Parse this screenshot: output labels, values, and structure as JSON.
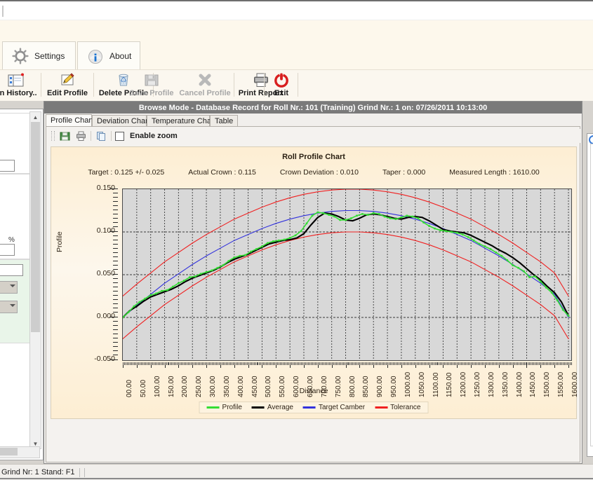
{
  "ribbon": {
    "tabs": [
      {
        "label": "Settings",
        "icon": "gear-icon"
      },
      {
        "label": "About",
        "icon": "info-icon"
      }
    ],
    "commands": [
      {
        "label": "en History..",
        "icon": "open-history-icon",
        "enabled": true
      },
      {
        "label": "Edit Profile",
        "icon": "pencil-icon",
        "enabled": true
      },
      {
        "label": "Delete Profile",
        "icon": "trash-icon",
        "enabled": true
      },
      {
        "label": "Save Profile",
        "icon": "floppy-disk-icon",
        "enabled": false
      },
      {
        "label": "Cancel Profile",
        "icon": "cross-icon",
        "enabled": false
      },
      {
        "label": "Print Report",
        "icon": "printer-icon",
        "enabled": true
      },
      {
        "label": "Exit",
        "icon": "power-icon",
        "enabled": true
      }
    ]
  },
  "window": {
    "title": "Browse Mode - Database Record for Roll Nr.: 101 (Training) Grind Nr.: 1 on: 07/26/2011 10:13:00"
  },
  "tabs": [
    {
      "label": "Profile Chart",
      "selected": true
    },
    {
      "label": "Deviation Chart",
      "selected": false
    },
    {
      "label": "Temperature Chart",
      "selected": false
    },
    {
      "label": "Table",
      "selected": false
    }
  ],
  "chart_toolbar": {
    "save_icon": "save-chart-icon",
    "print_icon": "print-chart-icon",
    "copy_icon": "copy-chart-icon",
    "enable_zoom_label": "Enable zoom",
    "enable_zoom_checked": false
  },
  "stats": [
    "Target : 0.125 +/- 0.025",
    "Actual Crown : 0.115",
    "Crown Deviation : 0.010",
    "Taper : 0.000",
    "Measured Length : 1610.00"
  ],
  "statusbar": {
    "text": "Grind Nr: 1  Stand: F1"
  },
  "colors": {
    "profile": "#33dd33",
    "average": "#000000",
    "target_camber": "#3232dc",
    "tolerance": "#f02020",
    "plot_bg": "#d8d8d8",
    "chart_bg": "#fdf0d9",
    "title_bar": "#7a7a7a"
  },
  "chart_data": {
    "type": "line",
    "title": "Roll Profile Chart",
    "xlabel": "Distance",
    "ylabel": "Profile",
    "xlim": [
      0,
      1610
    ],
    "ylim": [
      -0.05,
      0.15
    ],
    "yticks": [
      0.15,
      0.1,
      0.05,
      0.0,
      -0.05
    ],
    "ytick_labels": [
      "0.150",
      "0.100",
      "0.050",
      "0.000",
      "-0.050"
    ],
    "xticks": [
      0,
      50,
      100,
      150,
      200,
      250,
      300,
      350,
      400,
      450,
      500,
      550,
      600,
      650,
      700,
      750,
      800,
      850,
      900,
      950,
      1000,
      1050,
      1100,
      1150,
      1200,
      1250,
      1300,
      1350,
      1400,
      1450,
      1500,
      1550,
      1600
    ],
    "xtick_labels": [
      "00.00",
      "50.00",
      "100.00",
      "150.00",
      "200.00",
      "250.00",
      "300.00",
      "350.00",
      "400.00",
      "450.00",
      "500.00",
      "550.00",
      "600.00",
      "650.00",
      "700.00",
      "750.00",
      "800.00",
      "850.00",
      "900.00",
      "950.00",
      "1000.00",
      "1050.00",
      "1100.00",
      "1150.00",
      "1200.00",
      "1250.00",
      "1300.00",
      "1350.00",
      "1400.00",
      "1450.00",
      "1500.00",
      "1550.00",
      "1600.00"
    ],
    "grid": true,
    "legend_position": "bottom",
    "legend": [
      {
        "name": "Profile",
        "color": "#33dd33"
      },
      {
        "name": "Average",
        "color": "#000000"
      },
      {
        "name": "Target Camber",
        "color": "#3232dc"
      },
      {
        "name": "Tolerance",
        "color": "#f02020"
      }
    ],
    "series": [
      {
        "name": "Target Camber",
        "color": "#3232dc",
        "x": [
          0,
          50,
          100,
          150,
          200,
          250,
          300,
          350,
          400,
          450,
          500,
          550,
          600,
          650,
          700,
          750,
          800,
          850,
          900,
          950,
          1000,
          1050,
          1100,
          1150,
          1200,
          1250,
          1300,
          1350,
          1400,
          1450,
          1500,
          1550,
          1600
        ],
        "values": [
          0.0,
          0.014,
          0.027,
          0.04,
          0.051,
          0.062,
          0.072,
          0.081,
          0.09,
          0.097,
          0.104,
          0.11,
          0.115,
          0.119,
          0.122,
          0.124,
          0.125,
          0.125,
          0.124,
          0.122,
          0.119,
          0.115,
          0.11,
          0.104,
          0.097,
          0.09,
          0.081,
          0.072,
          0.062,
          0.051,
          0.04,
          0.027,
          0.0
        ]
      },
      {
        "name": "Tolerance Upper",
        "color": "#f02020",
        "x": [
          0,
          50,
          100,
          150,
          200,
          250,
          300,
          350,
          400,
          450,
          500,
          550,
          600,
          650,
          700,
          750,
          800,
          850,
          900,
          950,
          1000,
          1050,
          1100,
          1150,
          1200,
          1250,
          1300,
          1350,
          1400,
          1450,
          1500,
          1550,
          1600
        ],
        "values": [
          0.025,
          0.039,
          0.052,
          0.065,
          0.076,
          0.087,
          0.097,
          0.106,
          0.115,
          0.122,
          0.129,
          0.135,
          0.14,
          0.144,
          0.147,
          0.149,
          0.15,
          0.15,
          0.149,
          0.147,
          0.144,
          0.14,
          0.135,
          0.129,
          0.122,
          0.115,
          0.106,
          0.097,
          0.087,
          0.076,
          0.065,
          0.052,
          0.025
        ]
      },
      {
        "name": "Tolerance Lower",
        "color": "#f02020",
        "x": [
          0,
          50,
          100,
          150,
          200,
          250,
          300,
          350,
          400,
          450,
          500,
          550,
          600,
          650,
          700,
          750,
          800,
          850,
          900,
          950,
          1000,
          1050,
          1100,
          1150,
          1200,
          1250,
          1300,
          1350,
          1400,
          1450,
          1500,
          1550,
          1600
        ],
        "values": [
          -0.025,
          -0.011,
          0.002,
          0.015,
          0.026,
          0.037,
          0.047,
          0.056,
          0.065,
          0.072,
          0.079,
          0.085,
          0.09,
          0.094,
          0.097,
          0.099,
          0.1,
          0.1,
          0.099,
          0.097,
          0.094,
          0.09,
          0.085,
          0.079,
          0.072,
          0.065,
          0.056,
          0.047,
          0.037,
          0.026,
          0.015,
          0.002,
          -0.025
        ]
      },
      {
        "name": "Average",
        "color": "#000000",
        "x": [
          0,
          25,
          50,
          75,
          100,
          125,
          150,
          175,
          200,
          225,
          250,
          275,
          300,
          325,
          350,
          375,
          400,
          425,
          450,
          475,
          500,
          525,
          550,
          575,
          600,
          625,
          650,
          675,
          700,
          725,
          750,
          775,
          800,
          825,
          850,
          875,
          900,
          925,
          950,
          975,
          1000,
          1025,
          1050,
          1075,
          1100,
          1125,
          1150,
          1175,
          1200,
          1225,
          1250,
          1275,
          1300,
          1325,
          1350,
          1375,
          1400,
          1425,
          1450,
          1475,
          1500,
          1525,
          1550,
          1575,
          1600
        ],
        "values": [
          0.0,
          0.008,
          0.013,
          0.019,
          0.024,
          0.027,
          0.03,
          0.033,
          0.037,
          0.042,
          0.046,
          0.049,
          0.052,
          0.055,
          0.059,
          0.064,
          0.068,
          0.071,
          0.074,
          0.078,
          0.082,
          0.086,
          0.088,
          0.09,
          0.091,
          0.093,
          0.098,
          0.108,
          0.117,
          0.122,
          0.121,
          0.118,
          0.114,
          0.113,
          0.116,
          0.12,
          0.121,
          0.12,
          0.118,
          0.116,
          0.115,
          0.117,
          0.118,
          0.117,
          0.113,
          0.108,
          0.103,
          0.101,
          0.1,
          0.099,
          0.096,
          0.092,
          0.088,
          0.084,
          0.079,
          0.075,
          0.07,
          0.064,
          0.057,
          0.05,
          0.044,
          0.036,
          0.029,
          0.018,
          0.002
        ]
      },
      {
        "name": "Profile",
        "color": "#33dd33",
        "x": [
          0,
          20,
          40,
          60,
          80,
          100,
          120,
          140,
          160,
          180,
          200,
          220,
          240,
          260,
          280,
          300,
          320,
          340,
          360,
          380,
          400,
          420,
          440,
          460,
          480,
          500,
          520,
          540,
          560,
          580,
          600,
          620,
          640,
          660,
          680,
          700,
          720,
          740,
          760,
          780,
          800,
          820,
          840,
          860,
          880,
          900,
          920,
          940,
          960,
          980,
          1000,
          1020,
          1040,
          1060,
          1080,
          1100,
          1120,
          1140,
          1160,
          1180,
          1200,
          1220,
          1240,
          1260,
          1280,
          1300,
          1320,
          1340,
          1360,
          1380,
          1400,
          1420,
          1440,
          1460,
          1480,
          1500,
          1520,
          1540,
          1560,
          1580,
          1600
        ],
        "values": [
          0.0,
          0.006,
          0.013,
          0.018,
          0.022,
          0.026,
          0.028,
          0.031,
          0.032,
          0.036,
          0.04,
          0.043,
          0.047,
          0.048,
          0.051,
          0.053,
          0.055,
          0.058,
          0.061,
          0.066,
          0.07,
          0.072,
          0.073,
          0.077,
          0.08,
          0.083,
          0.087,
          0.089,
          0.09,
          0.091,
          0.093,
          0.096,
          0.101,
          0.11,
          0.119,
          0.123,
          0.122,
          0.12,
          0.118,
          0.114,
          0.114,
          0.116,
          0.119,
          0.121,
          0.12,
          0.122,
          0.121,
          0.118,
          0.116,
          0.115,
          0.117,
          0.119,
          0.118,
          0.116,
          0.111,
          0.107,
          0.104,
          0.102,
          0.101,
          0.1,
          0.099,
          0.097,
          0.094,
          0.09,
          0.086,
          0.083,
          0.08,
          0.076,
          0.072,
          0.067,
          0.061,
          0.058,
          0.054,
          0.047,
          0.048,
          0.042,
          0.035,
          0.029,
          0.02,
          0.009,
          0.002
        ]
      }
    ]
  }
}
